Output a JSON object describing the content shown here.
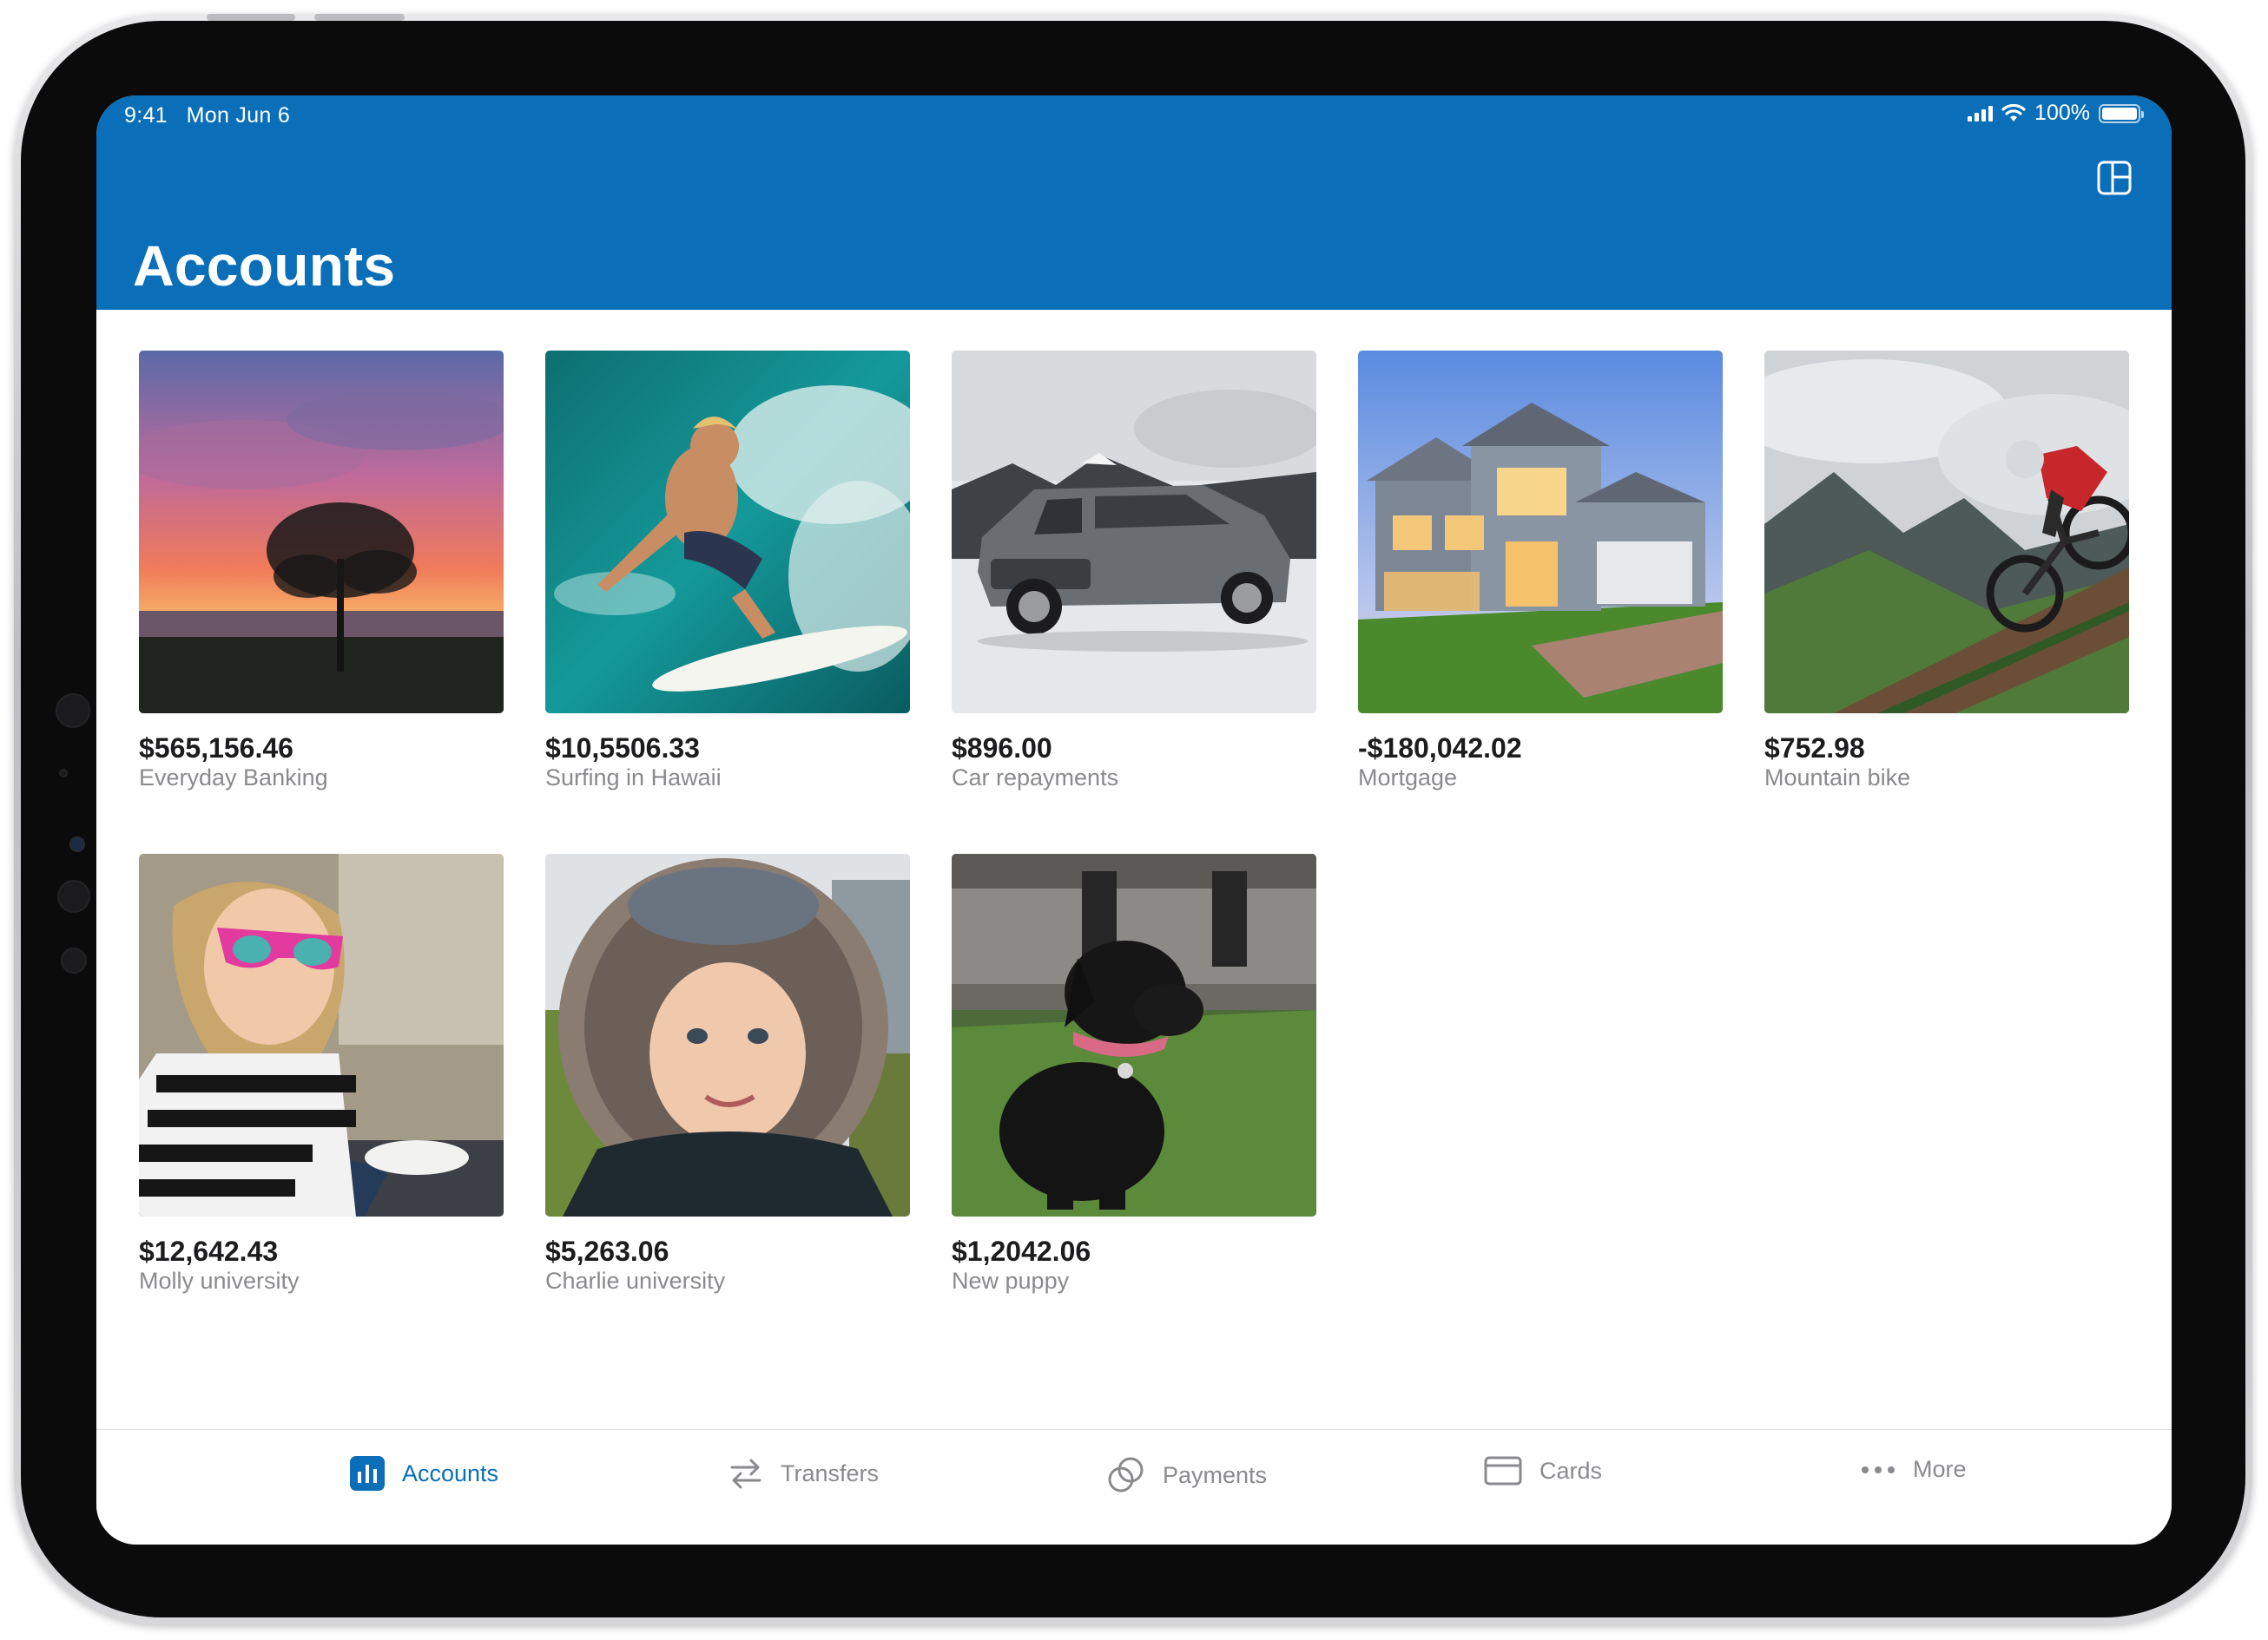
{
  "status_bar": {
    "time": "9:41",
    "date": "Mon Jun 6",
    "battery": "100%"
  },
  "header": {
    "title": "Accounts",
    "layout_button_icon": "sidebar-layout-icon"
  },
  "accounts": [
    {
      "amount": "$565,156.46",
      "name": "Everyday Banking",
      "image": "sunset-tree"
    },
    {
      "amount": "$10,5506.33",
      "name": "Surfing in Hawaii",
      "image": "surfer"
    },
    {
      "amount": "$896.00",
      "name": "Car repayments",
      "image": "suv"
    },
    {
      "amount": "-$180,042.02",
      "name": "Mortgage",
      "image": "house"
    },
    {
      "amount": "$752.98",
      "name": "Mountain bike",
      "image": "mountain-biker"
    },
    {
      "amount": "$12,642.43",
      "name": "Molly university",
      "image": "girl-sunglasses"
    },
    {
      "amount": "$5,263.06",
      "name": "Charlie university",
      "image": "boy-fur-hood"
    },
    {
      "amount": "$1,2042.06",
      "name": "New puppy",
      "image": "black-puppy"
    }
  ],
  "tabbar": {
    "tabs": [
      {
        "label": "Accounts",
        "icon": "chart-icon",
        "active": true
      },
      {
        "label": "Transfers",
        "icon": "arrows-icon",
        "active": false
      },
      {
        "label": "Payments",
        "icon": "circles-icon",
        "active": false
      },
      {
        "label": "Cards",
        "icon": "card-icon",
        "active": false
      },
      {
        "label": "More",
        "icon": "ellipsis-icon",
        "active": false
      }
    ]
  },
  "colors": {
    "brand": "#0a6eb8",
    "text_primary": "#1c1c1e",
    "text_secondary": "#8a8a8e"
  }
}
